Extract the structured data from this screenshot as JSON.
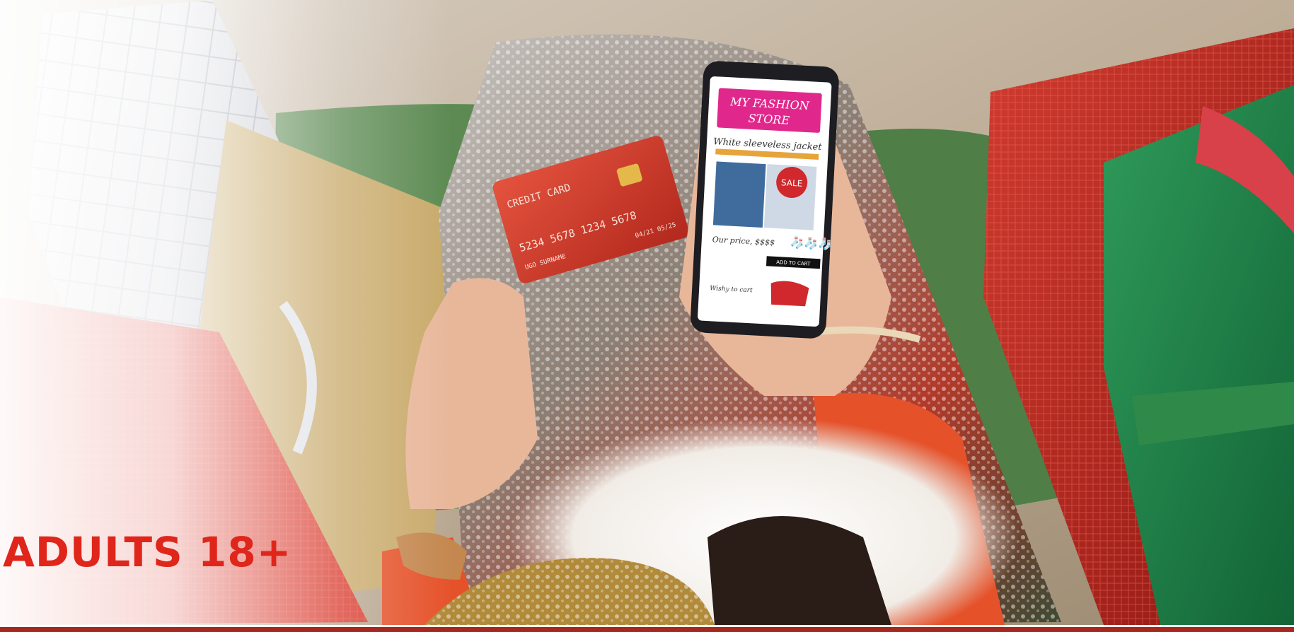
{
  "headline": "ADULTS 18+",
  "colors": {
    "accent": "#e0251b",
    "rule": "#a5281f",
    "phone_banner": "#e0288c"
  },
  "photo": {
    "credit_card": {
      "label": "CREDIT CARD",
      "number": "5234 5678 1234 5678",
      "name": "UGO SURNAME",
      "expiry": "04/21 05/25"
    },
    "phone": {
      "store_name_line1": "MY FASHION",
      "store_name_line2": "STORE",
      "product": "White sleeveless jacket",
      "sale_badge": "SALE",
      "price_label": "Our price, $$$$",
      "cart_button": "ADD TO CART",
      "wishlist": "Wishy to cart"
    }
  }
}
